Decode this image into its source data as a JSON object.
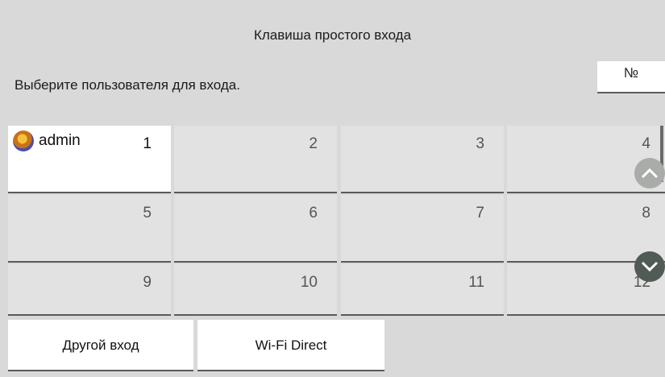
{
  "header": {
    "title": "Клавиша простого входа"
  },
  "instruction": "Выберите пользователя для входа.",
  "sort_button": {
    "label": "№"
  },
  "users": [
    {
      "num": "1",
      "name": "admin",
      "selected": true
    },
    {
      "num": "2",
      "name": ""
    },
    {
      "num": "3",
      "name": ""
    },
    {
      "num": "4",
      "name": ""
    },
    {
      "num": "5",
      "name": ""
    },
    {
      "num": "6",
      "name": ""
    },
    {
      "num": "7",
      "name": ""
    },
    {
      "num": "8",
      "name": ""
    },
    {
      "num": "9",
      "name": ""
    },
    {
      "num": "10",
      "name": ""
    },
    {
      "num": "11",
      "name": ""
    },
    {
      "num": "12",
      "name": ""
    }
  ],
  "footer": {
    "other_login": "Другой вход",
    "wifi_direct": "Wi-Fi Direct"
  },
  "icons": {
    "scroll_up": "chevron-up-icon",
    "scroll_down": "chevron-down-icon",
    "avatar": "user-avatar-icon"
  }
}
